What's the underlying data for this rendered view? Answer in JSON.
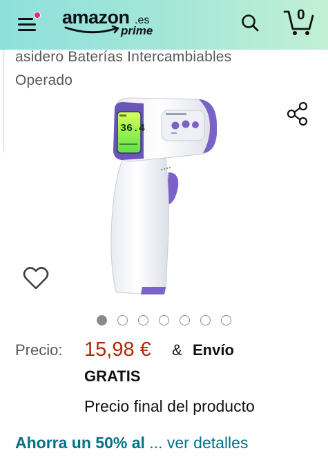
{
  "header": {
    "logo_word": "amazon",
    "logo_tld": ".es",
    "logo_prime": "prime",
    "cart_count": "0"
  },
  "product": {
    "title_line1": "asidero Baterías Intercambiables",
    "title_line2": "Operado",
    "display_reading": "36.4"
  },
  "carousel": {
    "total": 7,
    "active_index": 0
  },
  "price": {
    "label": "Precio:",
    "value": "15,98 €",
    "amp": "&",
    "shipping_1": "Envío",
    "shipping_2": "GRATIS",
    "final_note": "Precio final del producto"
  },
  "savings": {
    "strong_text": "Ahorra un 50% al",
    "link_text": "... ver detalles"
  },
  "icons": {
    "menu": "hamburger-menu-icon",
    "notification": "notification-dot-icon",
    "search": "search-icon",
    "cart": "cart-icon",
    "share": "share-icon",
    "wishlist": "heart-icon"
  },
  "colors": {
    "header_start": "#8ee0dc",
    "header_end": "#c2f0d4",
    "price": "#b12704",
    "link": "#007185",
    "notification": "#e3266f"
  }
}
